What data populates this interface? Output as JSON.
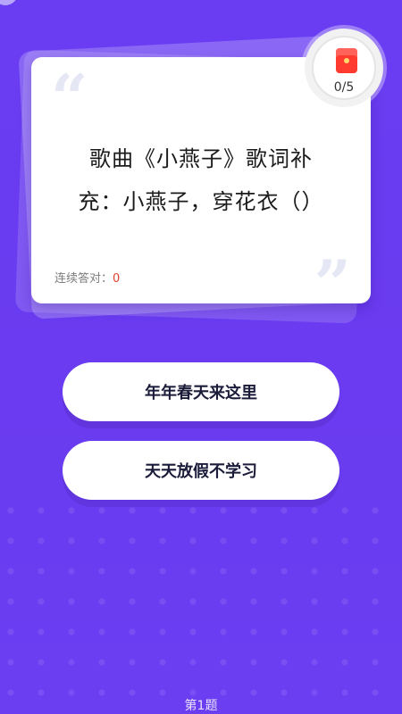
{
  "question": {
    "line1": "歌曲《小燕子》歌词补",
    "line2": "充：小燕子，穿花衣（）"
  },
  "streak": {
    "label": "连续答对：",
    "value": "0"
  },
  "redpack": {
    "count": "0/5"
  },
  "options": [
    {
      "label": "年年春天来这里"
    },
    {
      "label": "天天放假不学习"
    }
  ],
  "footer": {
    "question_number": "第1题"
  },
  "colors": {
    "background": "#6a3df2",
    "card": "#ffffff",
    "accent_red": "#e0402f"
  }
}
